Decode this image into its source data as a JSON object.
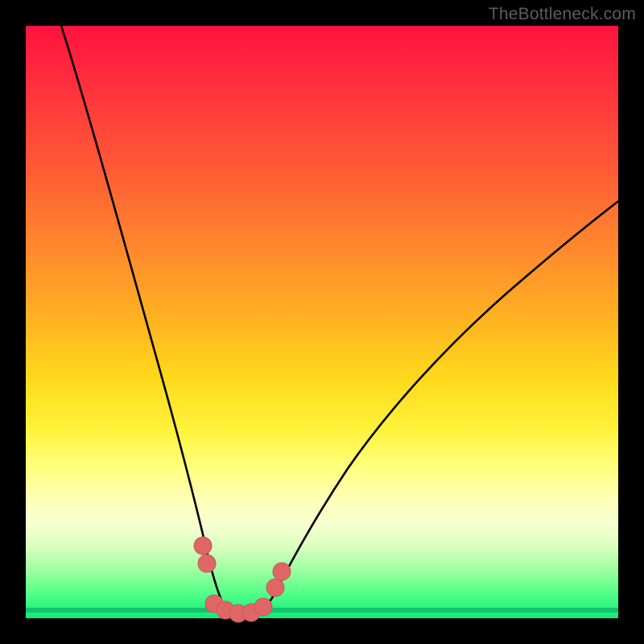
{
  "watermark": {
    "text": "TheBottleneck.com"
  },
  "colors": {
    "curve_stroke": "#000000",
    "marker_fill": "#e06666",
    "marker_stroke": "#b54848",
    "thick_green": "#12c36f"
  },
  "chart_data": {
    "type": "line",
    "title": "",
    "xlabel": "",
    "ylabel": "",
    "xlim": [
      0,
      100
    ],
    "ylim": [
      0,
      100
    ],
    "series": [
      {
        "name": "bottleneck-curve",
        "x": [
          6,
          10,
          14,
          18,
          22,
          25,
          27,
          29,
          30.5,
          32,
          33.3,
          36,
          39,
          42,
          45,
          50,
          58,
          66,
          75,
          85,
          95,
          100
        ],
        "y": [
          8,
          24,
          38,
          50,
          62,
          73,
          80,
          87,
          92,
          96,
          98.5,
          98.5,
          97,
          93,
          88,
          80,
          70,
          61,
          52,
          44,
          37,
          34
        ]
      }
    ],
    "markers": {
      "name": "highlight-points",
      "x": [
        29,
        30,
        30.5,
        32,
        34,
        36,
        38,
        40,
        41.5
      ],
      "y": [
        88,
        91,
        98,
        98.5,
        98.5,
        98.5,
        98,
        95,
        92
      ]
    }
  }
}
